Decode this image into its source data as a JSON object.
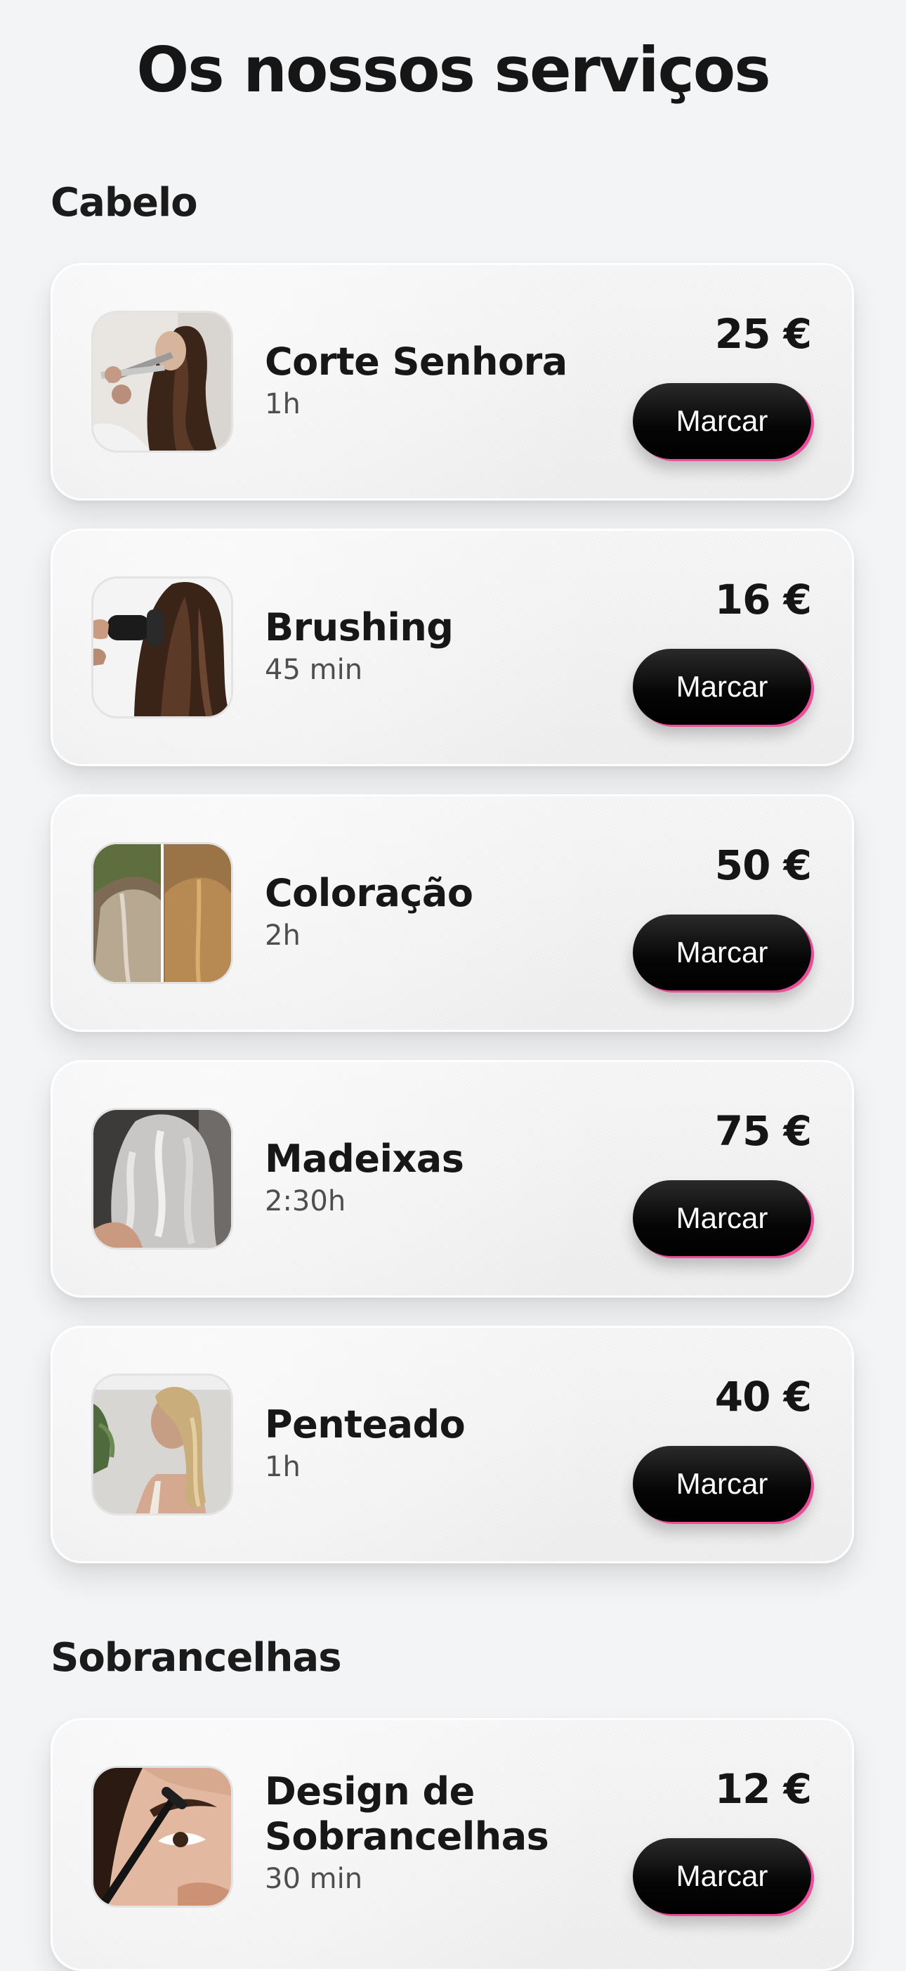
{
  "page": {
    "title": "Os nossos serviços"
  },
  "sections": [
    {
      "title": "Cabelo",
      "services": [
        {
          "name": "Corte Senhora",
          "duration": "1h",
          "price": "25 €",
          "button": "Marcar",
          "image_icon": "haircut-icon"
        },
        {
          "name": "Brushing",
          "duration": "45 min",
          "price": "16 €",
          "button": "Marcar",
          "image_icon": "hair-dryer-icon"
        },
        {
          "name": "Coloração",
          "duration": "2h",
          "price": "50 €",
          "button": "Marcar",
          "image_icon": "hair-color-icon"
        },
        {
          "name": "Madeixas",
          "duration": "2:30h",
          "price": "75 €",
          "button": "Marcar",
          "image_icon": "highlights-icon"
        },
        {
          "name": "Penteado",
          "duration": "1h",
          "price": "40 €",
          "button": "Marcar",
          "image_icon": "hairstyle-icon"
        }
      ]
    },
    {
      "title": "Sobrancelhas",
      "services": [
        {
          "name_line1": "Design de",
          "name_line2": "Sobrancelhas",
          "duration": "30 min",
          "price": "12 €",
          "button": "Marcar",
          "image_icon": "eyebrow-icon"
        }
      ]
    }
  ],
  "colors": {
    "background": "#f3f4f6",
    "button": "#050505",
    "button_accent": "#ee4b98",
    "text_primary": "#161616",
    "text_secondary": "#4e4e4e"
  }
}
